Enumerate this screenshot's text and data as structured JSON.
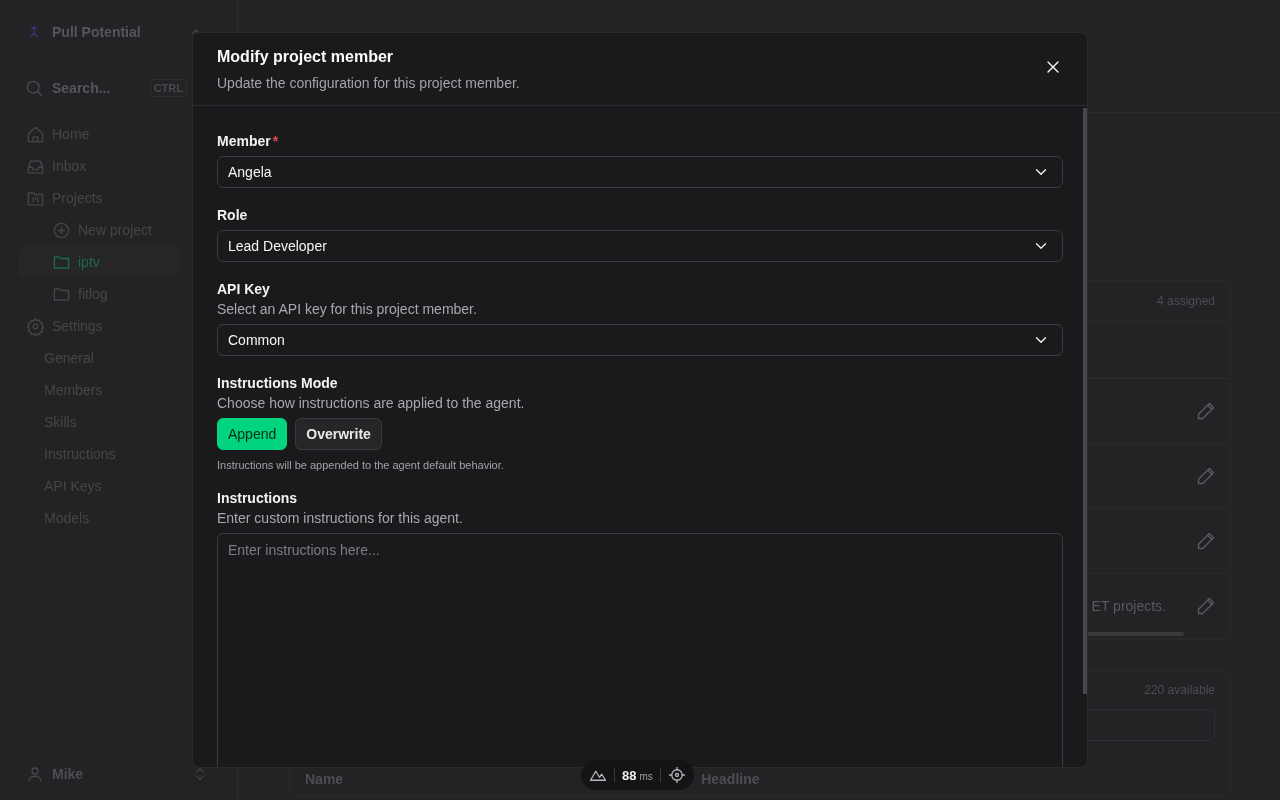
{
  "sidebar": {
    "workspace": {
      "name": "Pull Potential"
    },
    "search": {
      "placeholder": "Search...",
      "shortcut": "CTRL"
    },
    "items": [
      {
        "label": "Home",
        "selected": false
      },
      {
        "label": "Inbox",
        "selected": false
      },
      {
        "label": "Projects",
        "selected": false,
        "children": [
          {
            "label": "New project",
            "kind": "action",
            "selected": false
          },
          {
            "label": "iptv",
            "kind": "folder",
            "selected": true
          },
          {
            "label": "fitlog",
            "kind": "folder",
            "selected": false
          }
        ]
      },
      {
        "label": "Settings",
        "selected": false,
        "children": [
          {
            "label": "General",
            "kind": "page",
            "selected": false
          },
          {
            "label": "Members",
            "kind": "page",
            "selected": false
          },
          {
            "label": "Skills",
            "kind": "page",
            "selected": false
          },
          {
            "label": "Instructions",
            "kind": "page",
            "selected": false
          },
          {
            "label": "API Keys",
            "kind": "page",
            "selected": false
          },
          {
            "label": "Models",
            "kind": "page",
            "selected": false
          }
        ]
      }
    ],
    "user": {
      "name": "Mike"
    }
  },
  "main": {
    "members_card": {
      "count": "4 assigned",
      "rows": [
        {
          "editable": true
        },
        {
          "editable": true
        },
        {
          "editable": true
        },
        {
          "editable": true,
          "description": "ET projects."
        }
      ]
    },
    "skills_card": {
      "count": "220 available",
      "columns": [
        "Name",
        "Headline"
      ]
    }
  },
  "modal": {
    "title": "Modify project member",
    "subtitle": "Update the configuration for this project member.",
    "fields": [
      {
        "kind": "select",
        "label": "Member",
        "required_mark": "*",
        "value": "Angela"
      },
      {
        "kind": "select",
        "label": "Role",
        "value": "Lead Developer"
      },
      {
        "kind": "select",
        "label": "API Key",
        "description": "Select an API key for this project member.",
        "value": "Common"
      },
      {
        "kind": "toggle",
        "label": "Instructions Mode",
        "description": "Choose how instructions are applied to the agent.",
        "options": [
          {
            "label": "Append",
            "selected": true
          },
          {
            "label": "Overwrite",
            "selected": false
          }
        ],
        "note": "Instructions will be appended to the agent default behavior."
      },
      {
        "kind": "textarea",
        "label": "Instructions",
        "description": "Enter custom instructions for this agent.",
        "placeholder": "Enter instructions here..."
      }
    ]
  },
  "dev_toolbar": {
    "timing": "88",
    "unit": "ms"
  }
}
